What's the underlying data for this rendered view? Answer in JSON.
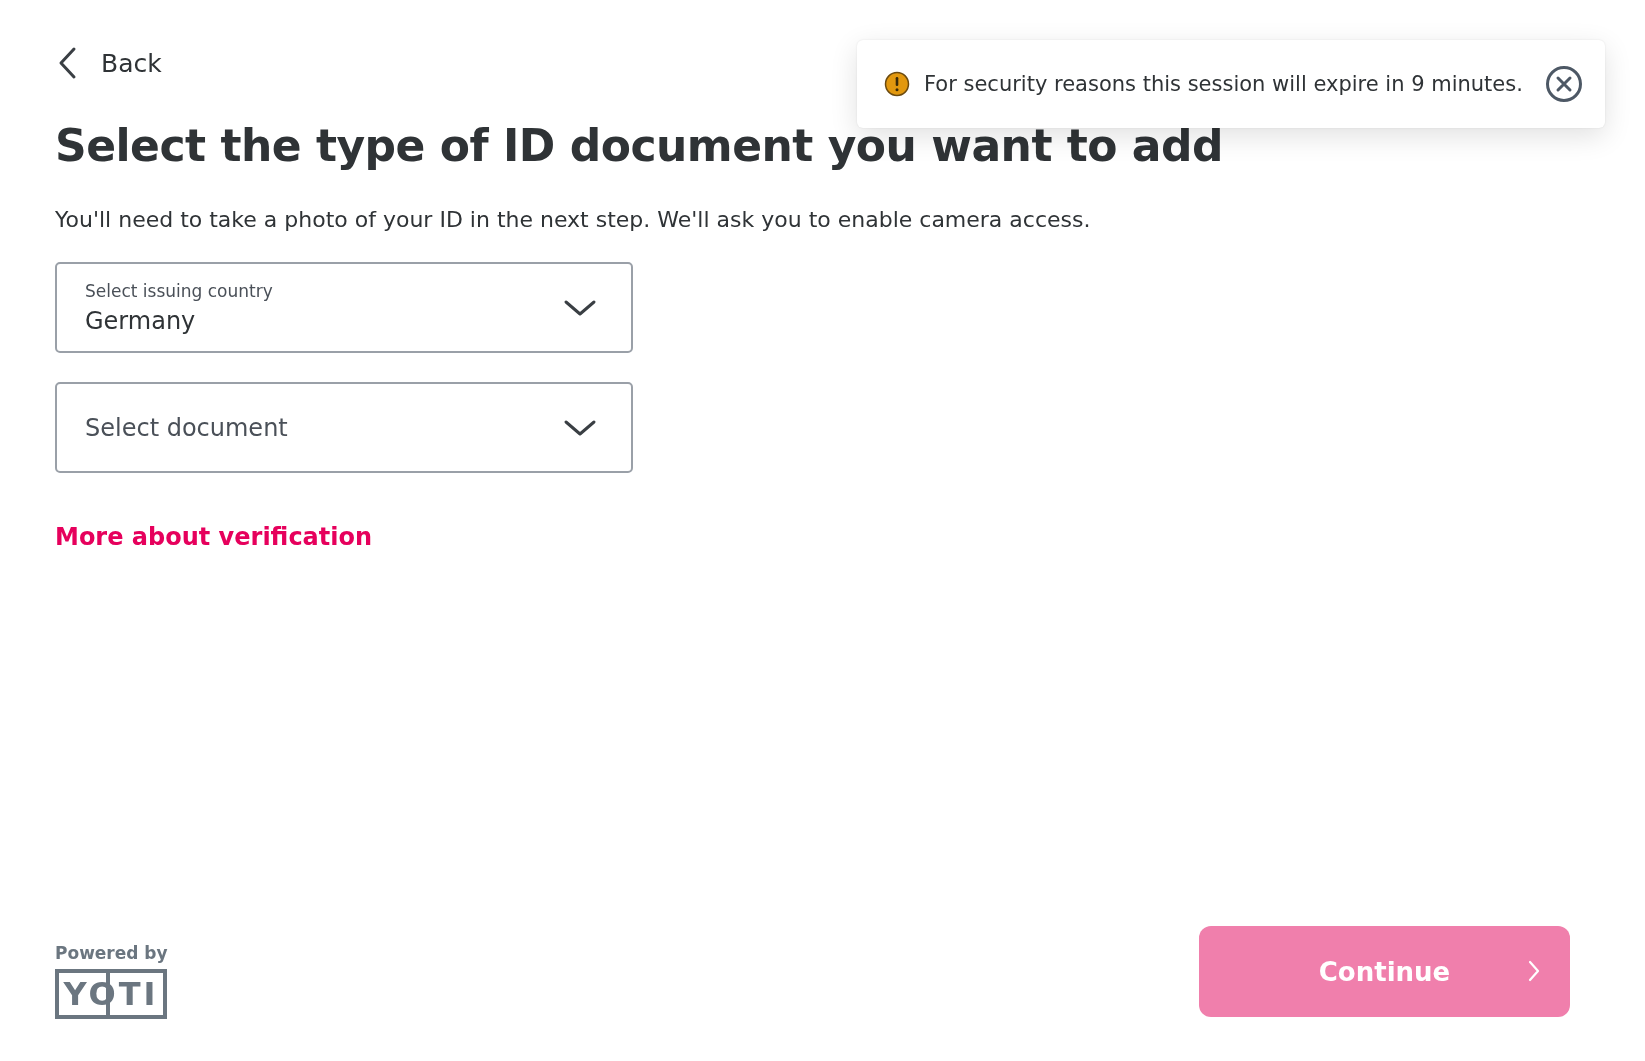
{
  "back": {
    "label": "Back"
  },
  "toast": {
    "message": "For security reasons this session will expire in 9 minutes."
  },
  "title": "Select the type of ID document you want to add",
  "subtitle": "You'll need to take a photo of your ID in the next step. We'll ask you to enable camera access.",
  "fields": [
    {
      "label": "Select issuing country",
      "value": "Germany"
    },
    {
      "placeholder": "Select document"
    }
  ],
  "link": "More about verification",
  "footer": {
    "powered_by": "Powered by",
    "logo": "YOTI"
  },
  "continue_button": {
    "label": "Continue",
    "disabled": true
  }
}
